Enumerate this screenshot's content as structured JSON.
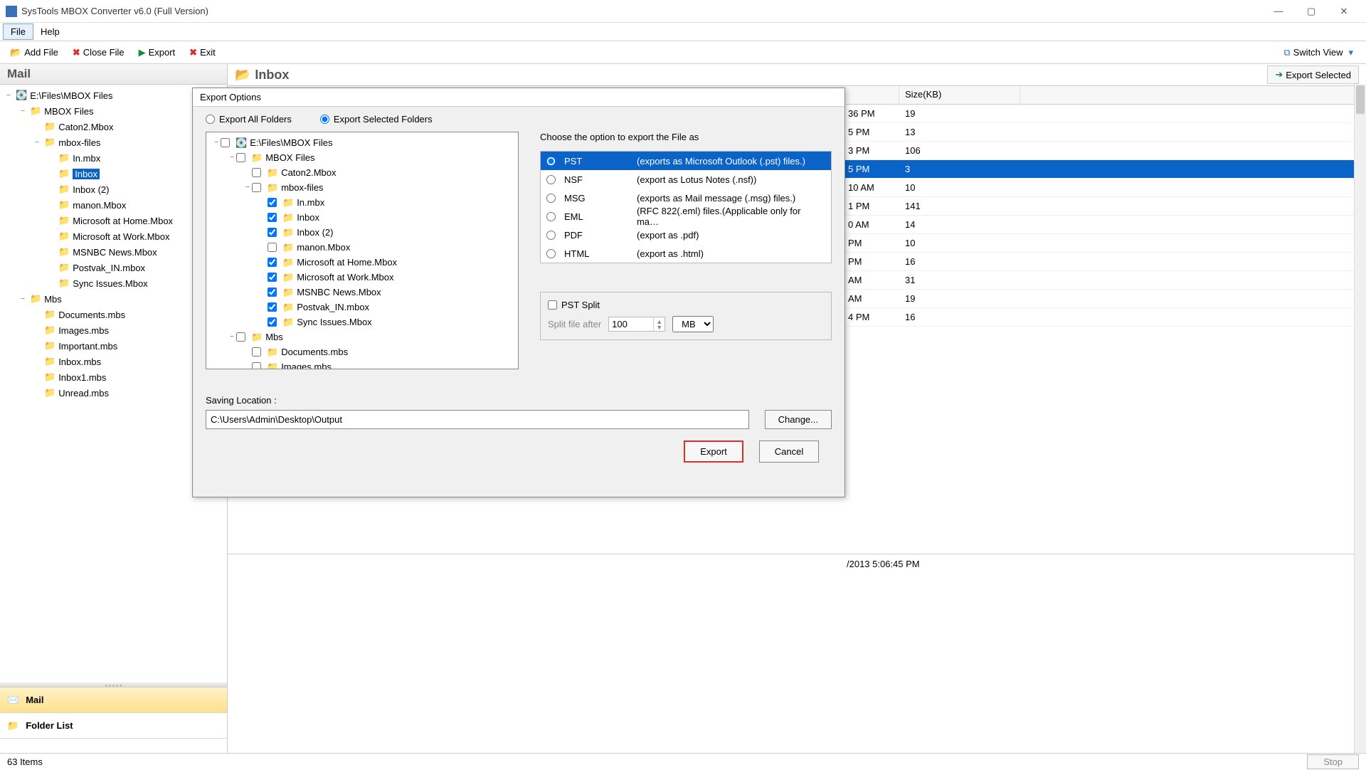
{
  "window": {
    "title": "SysTools MBOX Converter v6.0 (Full Version)"
  },
  "menu": {
    "file": "File",
    "help": "Help"
  },
  "toolbar": {
    "add_file": "Add File",
    "close_file": "Close File",
    "export": "Export",
    "exit": "Exit",
    "switch_view": "Switch View"
  },
  "left": {
    "header": "Mail",
    "tree": [
      {
        "indent": 0,
        "exp": "−",
        "label": "E:\\Files\\MBOX Files",
        "icon": "disk"
      },
      {
        "indent": 1,
        "exp": "−",
        "label": "MBOX Files"
      },
      {
        "indent": 2,
        "exp": "",
        "label": "Caton2.Mbox"
      },
      {
        "indent": 2,
        "exp": "−",
        "label": "mbox-files"
      },
      {
        "indent": 3,
        "exp": "",
        "label": "In.mbx"
      },
      {
        "indent": 3,
        "exp": "",
        "label": "Inbox",
        "selected": true
      },
      {
        "indent": 3,
        "exp": "",
        "label": "Inbox (2)"
      },
      {
        "indent": 3,
        "exp": "",
        "label": "manon.Mbox"
      },
      {
        "indent": 3,
        "exp": "",
        "label": "Microsoft at Home.Mbox"
      },
      {
        "indent": 3,
        "exp": "",
        "label": "Microsoft at Work.Mbox"
      },
      {
        "indent": 3,
        "exp": "",
        "label": "MSNBC News.Mbox"
      },
      {
        "indent": 3,
        "exp": "",
        "label": "Postvak_IN.mbox"
      },
      {
        "indent": 3,
        "exp": "",
        "label": "Sync Issues.Mbox"
      },
      {
        "indent": 1,
        "exp": "−",
        "label": "Mbs"
      },
      {
        "indent": 2,
        "exp": "",
        "label": "Documents.mbs"
      },
      {
        "indent": 2,
        "exp": "",
        "label": "Images.mbs"
      },
      {
        "indent": 2,
        "exp": "",
        "label": "Important.mbs"
      },
      {
        "indent": 2,
        "exp": "",
        "label": "Inbox.mbs"
      },
      {
        "indent": 2,
        "exp": "",
        "label": "Inbox1.mbs"
      },
      {
        "indent": 2,
        "exp": "",
        "label": "Unread.mbs"
      }
    ],
    "nav_mail": "Mail",
    "nav_folder": "Folder List"
  },
  "inbox": {
    "title": "Inbox",
    "export_selected": "Export Selected",
    "col_size": "Size(KB)",
    "rows": [
      {
        "time": "36 PM",
        "size": "19"
      },
      {
        "time": "5 PM",
        "size": "13"
      },
      {
        "time": "3 PM",
        "size": "106"
      },
      {
        "time": "5 PM",
        "size": "3",
        "selected": true
      },
      {
        "time": "10 AM",
        "size": "10"
      },
      {
        "time": "1 PM",
        "size": "141"
      },
      {
        "time": "0 AM",
        "size": "14"
      },
      {
        "time": "PM",
        "size": "10"
      },
      {
        "time": "PM",
        "size": "16"
      },
      {
        "time": "AM",
        "size": "31"
      },
      {
        "time": "AM",
        "size": "19"
      },
      {
        "time": "4 PM",
        "size": "16"
      }
    ],
    "preview_date": "/2013 5:06:45 PM"
  },
  "dialog": {
    "title": "Export Options",
    "export_all": "Export All Folders",
    "export_selected": "Export Selected Folders",
    "choose_hint": "Choose the option to export the File as",
    "tree": [
      {
        "indent": 0,
        "exp": "−",
        "chk": false,
        "label": "E:\\Files\\MBOX Files",
        "icon": "disk"
      },
      {
        "indent": 1,
        "exp": "−",
        "chk": false,
        "label": "MBOX Files"
      },
      {
        "indent": 2,
        "exp": "",
        "chk": false,
        "label": "Caton2.Mbox"
      },
      {
        "indent": 2,
        "exp": "−",
        "chk": false,
        "label": "mbox-files"
      },
      {
        "indent": 3,
        "exp": "",
        "chk": true,
        "label": "In.mbx"
      },
      {
        "indent": 3,
        "exp": "",
        "chk": true,
        "label": "Inbox"
      },
      {
        "indent": 3,
        "exp": "",
        "chk": true,
        "label": "Inbox (2)"
      },
      {
        "indent": 3,
        "exp": "",
        "chk": false,
        "label": "manon.Mbox"
      },
      {
        "indent": 3,
        "exp": "",
        "chk": true,
        "label": "Microsoft at Home.Mbox"
      },
      {
        "indent": 3,
        "exp": "",
        "chk": true,
        "label": "Microsoft at Work.Mbox"
      },
      {
        "indent": 3,
        "exp": "",
        "chk": true,
        "label": "MSNBC News.Mbox"
      },
      {
        "indent": 3,
        "exp": "",
        "chk": true,
        "label": "Postvak_IN.mbox"
      },
      {
        "indent": 3,
        "exp": "",
        "chk": true,
        "label": "Sync Issues.Mbox"
      },
      {
        "indent": 1,
        "exp": "−",
        "chk": false,
        "label": "Mbs"
      },
      {
        "indent": 2,
        "exp": "",
        "chk": false,
        "label": "Documents.mbs"
      },
      {
        "indent": 2,
        "exp": "",
        "chk": false,
        "label": "Images.mbs"
      }
    ],
    "formats": [
      {
        "key": "PST",
        "desc": "(exports as Microsoft Outlook (.pst) files.)",
        "selected": true
      },
      {
        "key": "NSF",
        "desc": "(export as Lotus Notes (.nsf))"
      },
      {
        "key": "MSG",
        "desc": "(exports as Mail message (.msg) files.)"
      },
      {
        "key": "EML",
        "desc": "(RFC 822(.eml) files.(Applicable only for ma…"
      },
      {
        "key": "PDF",
        "desc": "(export as .pdf)"
      },
      {
        "key": "HTML",
        "desc": "(export as .html)"
      }
    ],
    "pst_split": "PST Split",
    "split_after": "Split file after",
    "split_val": "100",
    "split_unit": "MB",
    "save_label": "Saving Location :",
    "save_path": "C:\\Users\\Admin\\Desktop\\Output",
    "change": "Change...",
    "export_btn": "Export",
    "cancel_btn": "Cancel"
  },
  "status": {
    "items": "63 Items",
    "stop": "Stop"
  }
}
